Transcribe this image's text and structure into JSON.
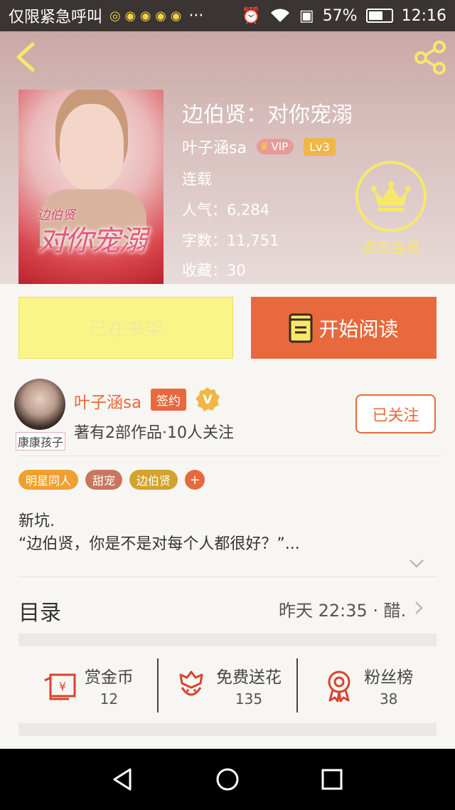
{
  "status_bar": {
    "left_text": "仅限紧急呼叫",
    "overflow": "···",
    "battery": "57%",
    "battery_level": 0.57,
    "time": "12:16"
  },
  "book": {
    "title": "边伯贤：对你宠溺",
    "cover_title": "对你宠溺",
    "cover_subtitle": "边伯贤",
    "author": "叶子涵sa",
    "vip_label": "VIP",
    "level": "Lv3",
    "status": "连载",
    "popularity": "人气：6,284",
    "word_count": "字数：11,751",
    "favorites": "收藏：30"
  },
  "member": {
    "label": "点亮会员"
  },
  "actions": {
    "shelf_label": "已在书架",
    "read_label": "开始阅读"
  },
  "author_card": {
    "name": "叶子涵sa",
    "sign_badge": "签约",
    "avatar_tag": "康康孩子",
    "works": "著有2部作品·10人关注",
    "follow_label": "已关注"
  },
  "tags": [
    {
      "label": "明星同人",
      "color": "#f0a030"
    },
    {
      "label": "甜宠",
      "color": "#c9765f"
    },
    {
      "label": "边伯贤",
      "color": "#d3a32f"
    }
  ],
  "intro": {
    "line1": "新坑.",
    "line2": "“边伯贤，你是不是对每个人都很好？”..."
  },
  "toc": {
    "label": "目录",
    "update": "昨天 22:35 · 醋."
  },
  "stats": [
    {
      "icon": "red-envelope-icon",
      "label": "赏金币",
      "value": "12"
    },
    {
      "icon": "flower-icon",
      "label": "免费送花",
      "value": "135"
    },
    {
      "icon": "medal-icon",
      "label": "粉丝榜",
      "value": "38"
    }
  ],
  "colors": {
    "accent": "#e8693d",
    "shelf_button": "#fbf587",
    "member_gold": "#f7e86a"
  }
}
